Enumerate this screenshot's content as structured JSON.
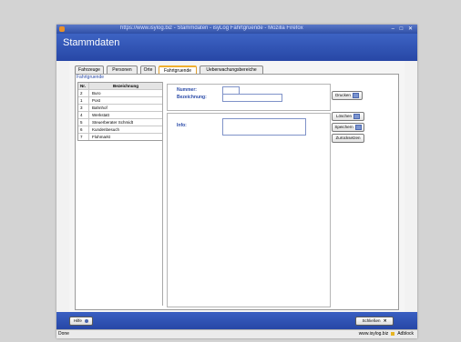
{
  "window": {
    "title": "https://www.isylog.biz - Stammdaten - isyLog Fahrtgruende - Mozilla Firefox",
    "controls": "– □ ✕"
  },
  "app": {
    "title": "Stammdaten"
  },
  "tabs": [
    {
      "label": "Fahrzeuge"
    },
    {
      "label": "Personen"
    },
    {
      "label": "Orte"
    },
    {
      "label": "Fahrtgruende"
    },
    {
      "label": "Ueberwachungsbereiche"
    }
  ],
  "group": {
    "label": "Fahrtgruende"
  },
  "table": {
    "headers": [
      "Nr.",
      "Bezeichnung"
    ],
    "rows": [
      {
        "nr": "2",
        "bez": "Buro"
      },
      {
        "nr": "1",
        "bez": "Post"
      },
      {
        "nr": "3",
        "bez": "Bahnhof"
      },
      {
        "nr": "4",
        "bez": "Werkstatt"
      },
      {
        "nr": "5",
        "bez": "Steuerberater Schmidt"
      },
      {
        "nr": "6",
        "bez": "Kundenbesuch"
      },
      {
        "nr": "7",
        "bez": "Flohmarkt"
      }
    ]
  },
  "form": {
    "nummer_label": "Nummer:",
    "bezeichnung_label": "Bezeichnung:",
    "info_label": "Info:",
    "nummer_value": "",
    "bezeichnung_value": "",
    "info_value": ""
  },
  "buttons": {
    "drucken": "Drucken",
    "loeschen": "Löschen",
    "speichern": "Speichern",
    "zuruecksetzen": "Zurücksetzen"
  },
  "footer": {
    "hilfe": "Hilfe",
    "schliessen": "Schließen"
  },
  "statusbar": {
    "left": "Done",
    "domain": "www.isylog.biz",
    "adblock": "Adblock"
  },
  "colors": {
    "header_blue": "#2f4fa6",
    "tab_active_accent": "#f0b030",
    "label_blue": "#2a4aa8"
  }
}
